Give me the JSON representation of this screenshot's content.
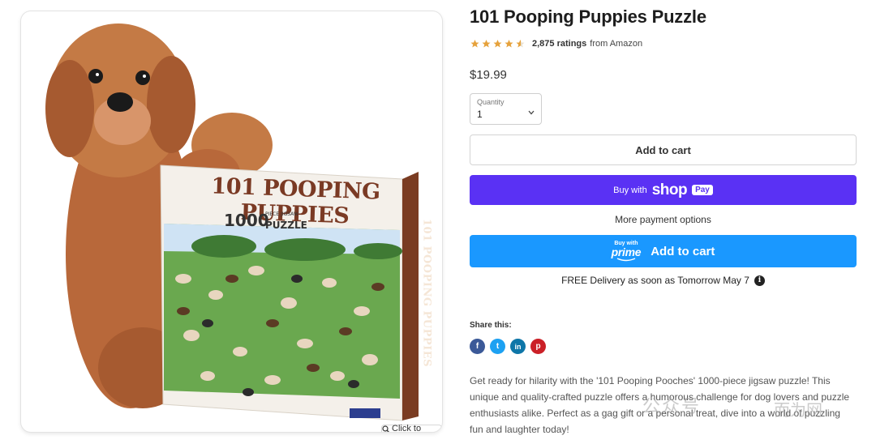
{
  "image": {
    "box_title": "101 POOPING PUPPIES",
    "box_count": "1000",
    "box_sub": "PIECE JIGSAW",
    "box_puzzle": "PUZZLE",
    "box_side": "101 POOPING PUPPIES",
    "expand_label": "Click to expand"
  },
  "product": {
    "title": "101 Pooping Puppies Puzzle",
    "rating_value": 4.5,
    "rating_count": "2,875 ratings",
    "rating_source": "from Amazon",
    "price": "$19.99"
  },
  "quantity": {
    "label": "Quantity",
    "value": "1"
  },
  "buttons": {
    "add_to_cart": "Add to cart",
    "buy_with": "Buy with",
    "shop": "shop",
    "pay": "Pay",
    "more_payment": "More payment options",
    "prime_buy_with": "Buy with",
    "prime": "prime",
    "prime_add_to_cart": "Add to cart"
  },
  "delivery": {
    "text": "FREE Delivery as soon as Tomorrow May 7"
  },
  "share": {
    "label": "Share this:",
    "icons": [
      {
        "name": "facebook-icon",
        "glyph": "f",
        "color": "#3b5998"
      },
      {
        "name": "twitter-icon",
        "glyph": "t",
        "color": "#1da1f2"
      },
      {
        "name": "linkedin-icon",
        "glyph": "in",
        "color": "#0e76a8"
      },
      {
        "name": "pinterest-icon",
        "glyph": "p",
        "color": "#cb2027"
      }
    ]
  },
  "description": "Get ready for hilarity with the '101 Pooping Pooches' 1000-piece jigsaw puzzle! This unique and quality-crafted puzzle offers a humorous challenge for dog lovers and puzzle enthusiasts alike. Perfect as a gag gift or a personal treat, dive into a world of puzzling fun and laughter today!",
  "watermark": {
    "left": "公众号",
    "right": "而为网"
  },
  "colors": {
    "shop_pay": "#5a31f4",
    "prime_blue": "#1a98ff",
    "star": "#e6a23c"
  }
}
